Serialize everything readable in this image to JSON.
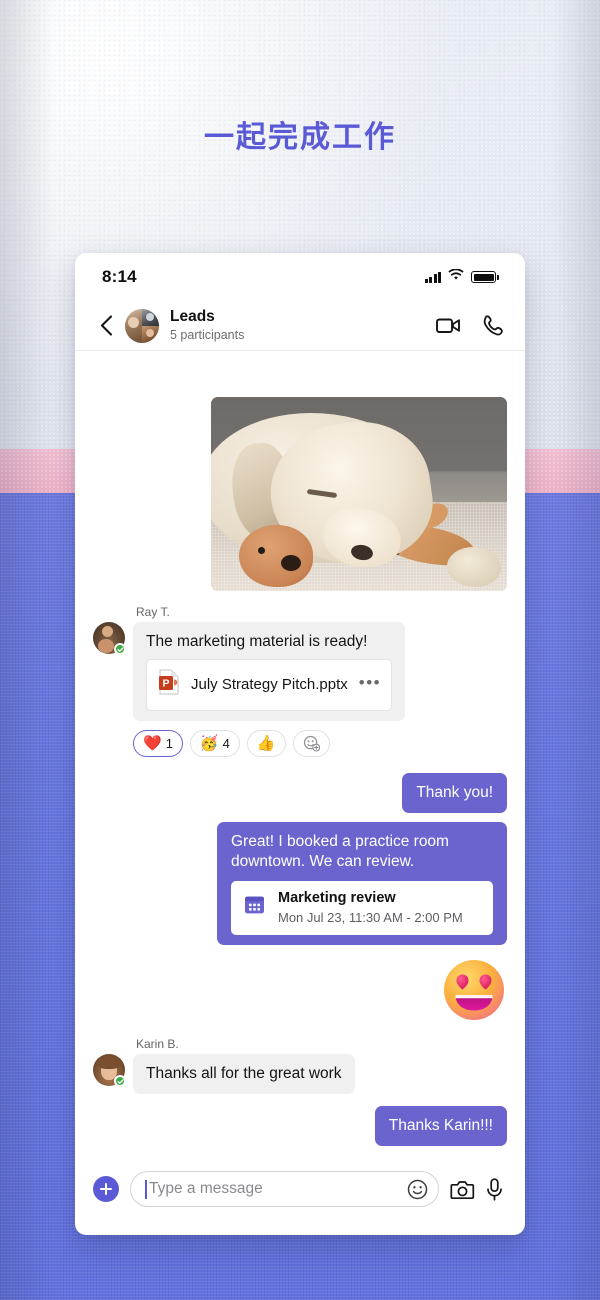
{
  "headline": "一起完成工作",
  "colors": {
    "accent_purple": "#6b63ce",
    "headline_purple": "#5b5ad6",
    "band_pink": "#f2b9cf",
    "band_blue": "#6878e2",
    "presence_green": "#3ea845",
    "powerpoint_orange": "#c43e1c"
  },
  "status_bar": {
    "time": "8:14",
    "signal_icon": "cellular-signal-icon",
    "wifi_icon": "wifi-icon",
    "battery_icon": "battery-icon"
  },
  "chat_header": {
    "back_icon": "chevron-left-icon",
    "avatar_name": "group-avatar",
    "title": "Leads",
    "subtitle": "5 participants",
    "video_call_icon": "video-camera-icon",
    "audio_call_icon": "phone-handset-icon"
  },
  "messages": [
    {
      "id": "photo",
      "direction": "outgoing",
      "type": "image",
      "image_alt": "sleeping-labrador-with-plush-toy-photo"
    },
    {
      "id": "ray-message",
      "direction": "incoming",
      "sender": "Ray T.",
      "avatar_name": "avatar-ray",
      "presence": "available",
      "text": "The marketing material is ready!",
      "attachment": {
        "icon": "powerpoint-file-icon",
        "name": "July Strategy Pitch.pptx",
        "more_label": "•••"
      },
      "reactions": [
        {
          "emoji": "❤️",
          "icon_name": "heart-reaction-icon",
          "count": "1",
          "selected": true
        },
        {
          "emoji": "🥳",
          "icon_name": "party-face-reaction-icon",
          "count": "4",
          "selected": false
        },
        {
          "emoji": "👍",
          "icon_name": "thumbs-up-reaction-icon",
          "count": "",
          "selected": false
        },
        {
          "emoji": "",
          "icon_name": "add-reaction-icon",
          "count": "",
          "selected": false
        }
      ]
    },
    {
      "id": "thank-you",
      "direction": "outgoing",
      "text": "Thank you!"
    },
    {
      "id": "practice-room",
      "direction": "outgoing",
      "text": "Great! I booked a practice room downtown. We can review.",
      "event_card": {
        "icon": "calendar-icon",
        "title": "Marketing review",
        "time": "Mon Jul 23, 11:30 AM - 2:00 PM"
      }
    },
    {
      "id": "sticker",
      "direction": "outgoing",
      "type": "sticker",
      "sticker_name": "heart-eyes-emoji-sticker"
    },
    {
      "id": "karin-message",
      "direction": "incoming",
      "sender": "Karin B.",
      "avatar_name": "avatar-karin",
      "presence": "available",
      "text": "Thanks all for the great work"
    },
    {
      "id": "thanks-karin",
      "direction": "outgoing",
      "text": "Thanks Karin!!!"
    }
  ],
  "compose": {
    "add_button_label": "+",
    "add_button_icon": "plus-icon",
    "input_value": "",
    "input_placeholder": "Type a message",
    "emoji_icon": "smiley-face-icon",
    "camera_icon": "camera-icon",
    "microphone_icon": "microphone-icon"
  }
}
